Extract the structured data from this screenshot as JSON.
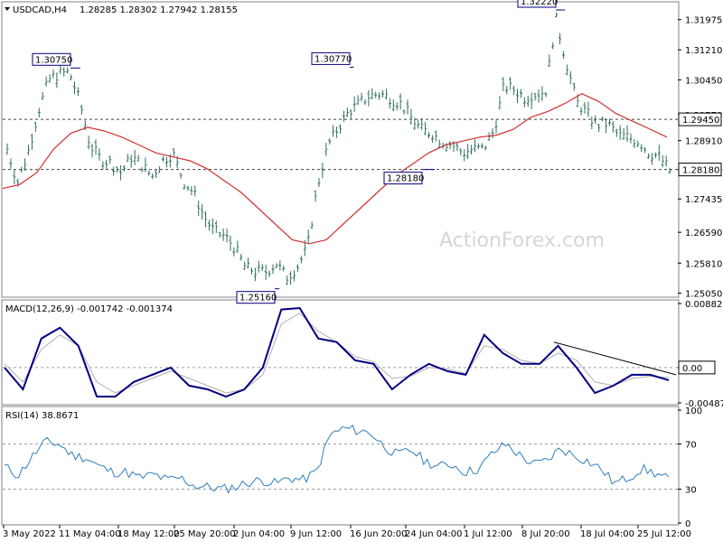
{
  "panels": {
    "price": {
      "title_symbol": "USDCAD,H4",
      "ohlc_readout": "1.28285 1.28302 1.27942 1.28155",
      "yticks": [
        "1.31975",
        "1.31210",
        "1.30450",
        "1.29570",
        "1.28910",
        "1.28180",
        "1.27435",
        "1.26590",
        "1.25810",
        "1.25050"
      ],
      "ylim": [
        1.2497,
        1.3238
      ],
      "annotations": [
        "1.30750",
        "1.30770",
        "1.32220",
        "1.28180",
        "1.25160"
      ],
      "hlines": [
        {
          "value": "1.29450",
          "label": "1.29450"
        },
        {
          "value": "1.28180",
          "label": "1.28180"
        }
      ]
    },
    "macd": {
      "title": "MACD(12,26,9) -0.001742 -0.001374",
      "yticks": [
        "0.00882",
        "0.00",
        "-0.004872"
      ],
      "zero_label": "0.00"
    },
    "rsi": {
      "title": "RSI(14) 38.8671",
      "yticks": [
        "100",
        "70",
        "30",
        "0"
      ],
      "levels": [
        70,
        30
      ]
    }
  },
  "xaxis": {
    "labels": [
      "3 May 2022",
      "11 May 04:00",
      "18 May 12:00",
      "25 May 20:00",
      "2 Jun 04:00",
      "9 Jun 12:00",
      "16 Jun 20:00",
      "24 Jun 04:00",
      "1 Jul 12:00",
      "8 Jul 20:00",
      "18 Jul 04:00",
      "25 Jul 12:00"
    ]
  },
  "watermark": "ActionForex.com",
  "colors": {
    "bars": "#2f6f5f",
    "ma": "#d03030",
    "macd": "#000080",
    "signal": "#b0b0b0",
    "rsi": "#2f7fc0",
    "trendline": "#000000"
  },
  "chart_data": [
    {
      "type": "line",
      "title": "USDCAD,H4",
      "series": [
        {
          "name": "price (approx close, sampled)",
          "values": [
            1.287,
            1.2785,
            1.286,
            1.2965,
            1.3045,
            1.306,
            1.3065,
            1.299,
            1.288,
            1.2845,
            1.2835,
            1.281,
            1.285,
            1.283,
            1.28,
            1.284,
            1.286,
            1.279,
            1.276,
            1.27,
            1.266,
            1.265,
            1.262,
            1.257,
            1.256,
            1.256,
            1.258,
            1.2545,
            1.257,
            1.262,
            1.278,
            1.288,
            1.2925,
            1.2965,
            1.2985,
            1.3005,
            1.301,
            1.3,
            1.2985,
            1.295,
            1.292,
            1.291,
            1.289,
            1.288,
            1.286,
            1.287,
            1.287,
            1.2915,
            1.303,
            1.302,
            1.3,
            1.301,
            1.3015,
            1.32,
            1.309,
            1.299,
            1.296,
            1.293,
            1.2935,
            1.2905,
            1.29,
            1.289,
            1.286,
            1.285,
            1.2815
          ]
        },
        {
          "name": "moving average (approx)",
          "values": [
            1.277,
            1.278,
            1.281,
            1.287,
            1.291,
            1.2925,
            1.2915,
            1.29,
            1.288,
            1.286,
            1.285,
            1.284,
            1.282,
            1.279,
            1.276,
            1.272,
            1.268,
            1.264,
            1.263,
            1.264,
            1.268,
            1.272,
            1.276,
            1.28,
            1.283,
            1.286,
            1.288,
            1.289,
            1.29,
            1.2905,
            1.292,
            1.295,
            1.2965,
            1.2985,
            1.301,
            1.299,
            1.296,
            1.294,
            1.292,
            1.29
          ]
        }
      ]
    },
    {
      "type": "line",
      "title": "MACD(12,26,9)",
      "series": [
        {
          "name": "MACD",
          "values": [
            0.0,
            -0.003,
            0.004,
            0.0055,
            0.003,
            -0.004,
            -0.004,
            -0.002,
            -0.001,
            0.0,
            -0.0025,
            -0.003,
            -0.004,
            -0.003,
            0.0,
            0.008,
            0.0082,
            0.004,
            0.0035,
            0.001,
            0.0005,
            -0.003,
            -0.001,
            0.0005,
            -0.0005,
            -0.001,
            0.0045,
            0.002,
            0.0005,
            0.0005,
            0.003,
            0.0,
            -0.0035,
            -0.0025,
            -0.001,
            -0.001,
            -0.001742
          ]
        },
        {
          "name": "Signal",
          "values": [
            0.0005,
            -0.002,
            0.0025,
            0.0045,
            0.003,
            -0.002,
            -0.0035,
            -0.0025,
            -0.0015,
            -0.0005,
            -0.0015,
            -0.0025,
            -0.0035,
            -0.003,
            -0.001,
            0.006,
            0.0075,
            0.005,
            0.0035,
            0.0015,
            0.0008,
            -0.0015,
            -0.0012,
            0.0,
            -0.0002,
            -0.0008,
            0.003,
            0.0025,
            0.001,
            0.0005,
            0.002,
            0.001,
            -0.002,
            -0.0025,
            -0.0015,
            -0.0012,
            -0.001374
          ]
        }
      ],
      "ylim": [
        -0.004872,
        0.00882
      ]
    },
    {
      "type": "line",
      "title": "RSI(14)",
      "series": [
        {
          "name": "RSI(14)",
          "values": [
            50,
            42,
            58,
            72,
            70,
            60,
            58,
            50,
            45,
            45,
            40,
            43,
            38,
            40,
            33,
            32,
            30,
            32,
            36,
            38,
            35,
            40,
            38,
            45,
            78,
            84,
            82,
            80,
            68,
            60,
            65,
            55,
            50,
            52,
            45,
            48,
            62,
            70,
            60,
            52,
            55,
            66,
            60,
            55,
            48,
            35,
            40,
            48,
            44,
            38.8671
          ]
        }
      ],
      "ylim": [
        0,
        100
      ]
    }
  ]
}
